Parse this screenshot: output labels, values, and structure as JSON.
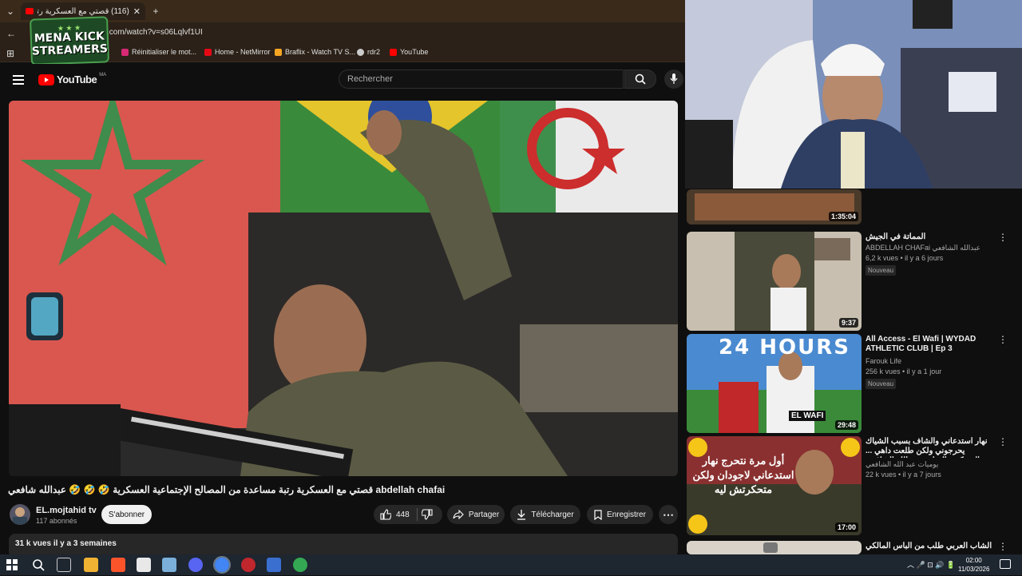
{
  "browser": {
    "tab_title": "(116) قصتي مع العسكرية رتبة",
    "url": ".com/watch?v=s06Lqlvf1UI",
    "bookmarks": [
      {
        "label": "Réinitialiser le mot...",
        "color": "#d62976"
      },
      {
        "label": "Home - NetMirror",
        "color": "#e50914"
      },
      {
        "label": "Braflix - Watch TV S...",
        "color": "#f5a623"
      },
      {
        "label": "rdr2",
        "color": "#cccccc"
      },
      {
        "label": "YouTube",
        "color": "#ff0000"
      }
    ]
  },
  "overlay_logo": {
    "line1": "MENA KICK",
    "line2": "STREAMERS"
  },
  "youtube": {
    "logo_text": "YouTube",
    "logo_region": "MA",
    "search_placeholder": "Rechercher"
  },
  "video": {
    "title": "قصتي مع العسكرية رتبة مساعدة من المصالح الإجتماعية العسكرية 🤣 🤣 🤣 عبدالله شافعي abdellah chafai",
    "channel_name": "EL.mojtahid tv",
    "subscribers": "117 abonnés",
    "subscribe_label": "S'abonner",
    "likes": "448",
    "share_label": "Partager",
    "download_label": "Télécharger",
    "save_label": "Enregistrer",
    "views_date": "31 k vues  il y a 3 semaines"
  },
  "sidebar": [
    {
      "title": "",
      "channel": "",
      "meta": "",
      "badge": "",
      "duration": "1:35:04"
    },
    {
      "title": "المماتة في الجيش",
      "channel": "ABDELLAH CHAFai عبدالله الشافعي",
      "meta": "6,2 k vues • il y a 6 jours",
      "badge": "Nouveau",
      "duration": "9:37"
    },
    {
      "title": "All Access - El Wafi | WYDAD ATHLETIC CLUB | Ep 3",
      "channel": "Farouk Life",
      "meta": "256 k vues • il y a 1 jour",
      "badge": "Nouveau",
      "duration": "29:48"
    },
    {
      "title": "نهار استدعاني والشاف بسبب الشياك يحرجوني ولكن طلعت داهي ... العسكري السابق عبد الله الشافعي",
      "channel": "يوميات عبد الله الشافعي",
      "meta": "22 k vues • il y a 7 jours",
      "badge": "",
      "duration": "17:00"
    },
    {
      "title": "الشاب العربي طلب من الباس المالكي طوسة ما بغاش",
      "channel": "",
      "meta": "",
      "badge": "",
      "duration": ""
    }
  ],
  "thumb_text": {
    "t3": "24 HOURS",
    "t3b": "EL WAFI",
    "t4": "أول مرة نتحرج نهار استدعاني لاجودان ولكن متحكرتش ليه"
  },
  "taskbar": {
    "time": "02:00",
    "date": "11/03/2026"
  }
}
